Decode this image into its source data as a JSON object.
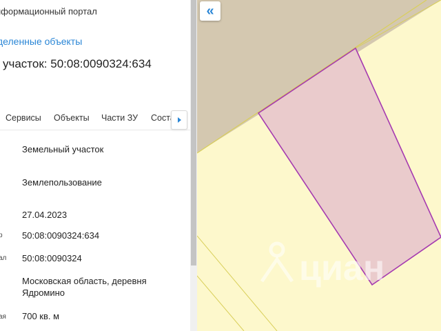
{
  "header": {
    "portal_title": "нформационный портал",
    "selected_objects_link": "деленные объекты",
    "parcel_heading": "участок: 50:08:0090324:634"
  },
  "tabs": [
    "Сервисы",
    "Объекты",
    "Части ЗУ",
    "Соста"
  ],
  "rows": [
    {
      "label": "",
      "value": "Земельный участок"
    },
    {
      "label": "",
      "value": "Землепользование"
    },
    {
      "label": "",
      "value": "27.04.2023"
    },
    {
      "label": "р",
      "value": "50:08:0090324:634"
    },
    {
      "label": "ал",
      "value": "50:08:0090324"
    },
    {
      "label": "",
      "value": "Московская область, деревня Ядромино"
    },
    {
      "label": "ая",
      "value": "700 кв. м"
    }
  ],
  "map": {
    "collapse_button": "«",
    "watermark_text": "циан",
    "colors": {
      "background_parcel": "#d4c8b0",
      "neighbor_parcel": "#fdf8cc",
      "selected_parcel_fill": "#eacbcc",
      "selected_parcel_stroke": "#a53ab0",
      "boundary_line": "#d9cf5a"
    }
  },
  "icons": {
    "tabs_scroll": "caret-right-icon",
    "collapse": "double-chevron-left-icon",
    "watermark": "cian-logo-icon"
  }
}
